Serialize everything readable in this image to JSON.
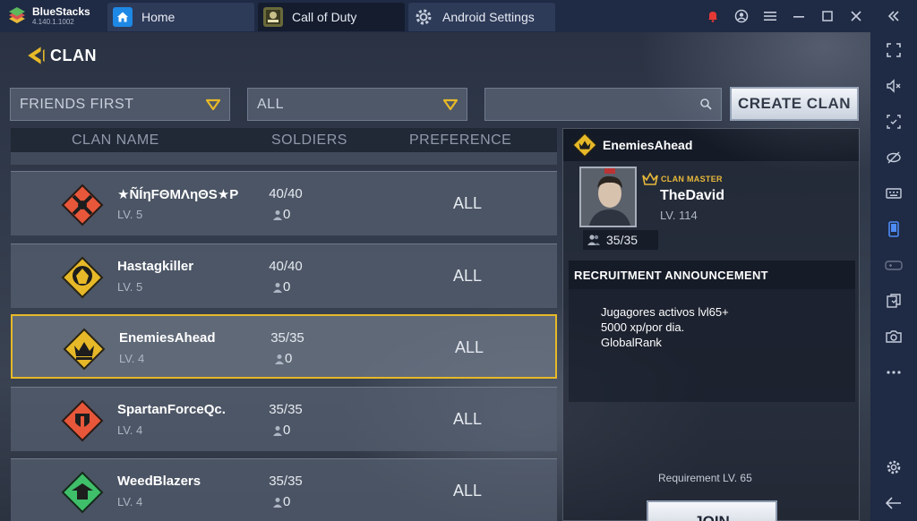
{
  "app": {
    "name": "BlueStacks",
    "version": "4.140.1.1002",
    "colors": {
      "chrome": "#1f2a44",
      "accent_gold": "#e7b928"
    }
  },
  "tabs": [
    {
      "label": "Home",
      "icon": "home-icon"
    },
    {
      "label": "Call of Duty",
      "icon": "call-of-duty-icon"
    },
    {
      "label": "Android Settings",
      "icon": "gear-icon"
    }
  ],
  "window_controls": [
    "notification-bell-icon",
    "account-icon",
    "menu-icon",
    "minimize-icon",
    "maximize-icon",
    "close-icon",
    "collapse-sidebar-icon"
  ],
  "sidebar": [
    "fullscreen-icon",
    "volume-icon",
    "screenshot-region-icon",
    "eye-off-icon",
    "keyboard-icon",
    "phone-icon",
    "gamepad-icon",
    "copy-icon",
    "camera-icon",
    "more-icon",
    "settings-icon",
    "back-arrow-icon"
  ],
  "game": {
    "back_label": "CLAN",
    "filter_sort": "FRIENDS FIRST",
    "filter_pref": "ALL",
    "search_placeholder": "",
    "create_label": "CREATE CLAN",
    "columns": {
      "name": "CLAN NAME",
      "soldiers": "SOLDIERS",
      "preference": "PREFERENCE"
    },
    "clans": [
      {
        "name": "★ÑÍηFΘMΛηΘS★P",
        "level": "LV. 5",
        "soldiers": "40/40",
        "online": "0",
        "preference": "ALL",
        "emblem_color": "#e8573a"
      },
      {
        "name": "Hastagkiller",
        "level": "LV. 5",
        "soldiers": "40/40",
        "online": "0",
        "preference": "ALL",
        "emblem_color": "#e7b928"
      },
      {
        "name": "EnemiesAhead",
        "level": "LV. 4",
        "soldiers": "35/35",
        "online": "0",
        "preference": "ALL",
        "emblem_color": "#e7b928"
      },
      {
        "name": "SpartanForceQc.",
        "level": "LV. 4",
        "soldiers": "35/35",
        "online": "0",
        "preference": "ALL",
        "emblem_color": "#e8573a"
      },
      {
        "name": "WeedBlazers",
        "level": "LV. 4",
        "soldiers": "35/35",
        "online": "0",
        "preference": "ALL",
        "emblem_color": "#3fbf6a"
      }
    ],
    "detail": {
      "clan_name": "EnemiesAhead",
      "master_badge": "CLAN MASTER",
      "master_name": "TheDavid",
      "master_level": "LV. 114",
      "members": "35/35",
      "recruit_title": "RECRUITMENT ANNOUNCEMENT",
      "recruit_lines": [
        "Jugagores activos lvl65+",
        "5000 xp/por dia.",
        "GlobalRank"
      ],
      "requirement": "Requirement  LV. 65",
      "join_label": "JOIN"
    }
  }
}
